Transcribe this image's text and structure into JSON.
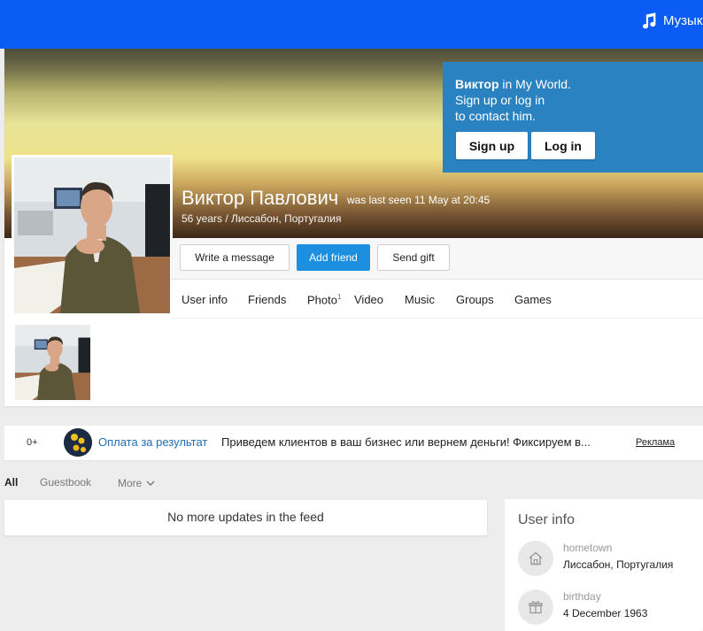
{
  "topbar": {
    "music_label": "Музык"
  },
  "promo": {
    "name": "Виктор",
    "line1_rest": " in My World.",
    "line2": "Sign up or log in",
    "line3": "to contact him.",
    "signup_label": "Sign up",
    "login_label": "Log in"
  },
  "profile": {
    "name": "Виктор Павлович",
    "last_seen": "was last seen 11 May at 20:45",
    "subtitle": "56 years / Лиссабон, Португалия"
  },
  "actions": {
    "message": "Write a message",
    "add_friend": "Add friend",
    "gift": "Send gift"
  },
  "tabs": [
    {
      "label": "User info"
    },
    {
      "label": "Friends"
    },
    {
      "label": "Photo",
      "count": "1"
    },
    {
      "label": "Video"
    },
    {
      "label": "Music"
    },
    {
      "label": "Groups"
    },
    {
      "label": "Games"
    }
  ],
  "ad": {
    "count": "0+",
    "title": "Оплата за результат",
    "text": "Приведем клиентов в ваш бизнес или вернем деньги! Фиксируем в...",
    "label": "Реклама"
  },
  "feed_tabs": {
    "all": "All",
    "guestbook": "Guestbook",
    "more": "More"
  },
  "feed": {
    "empty": "No more updates in the feed"
  },
  "user_info": {
    "title": "User info",
    "hometown_label": "hometown",
    "hometown_value": "Лиссабон, Португалия",
    "birthday_label": "birthday",
    "birthday_value": "4 December 1963"
  },
  "colors": {
    "topbar": "#0a5cf5",
    "promo": "#2b82c0",
    "primary_button": "#1d8fe0",
    "link": "#1d6fb8"
  }
}
